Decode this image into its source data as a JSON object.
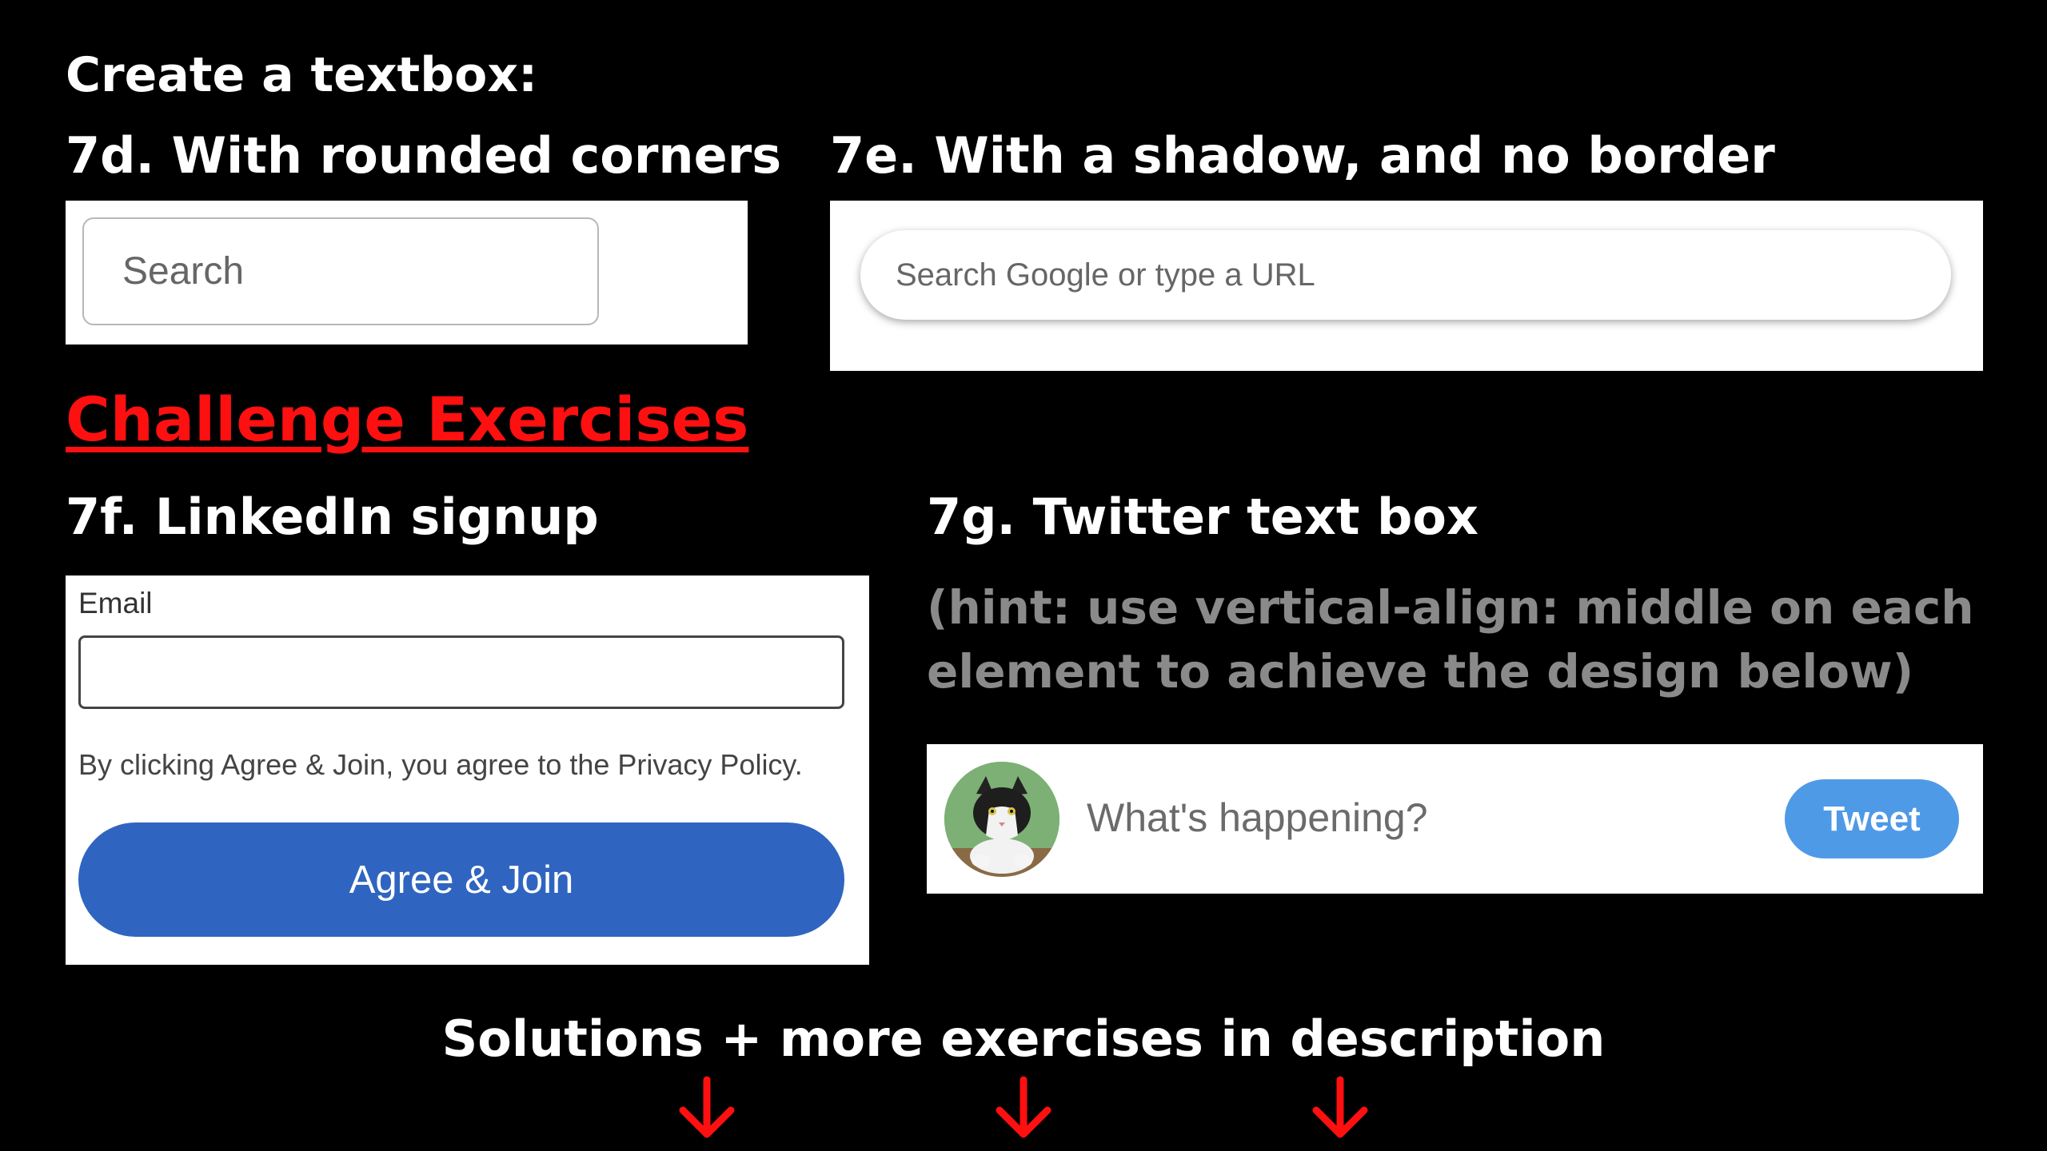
{
  "header": {
    "title": "Create a textbox:"
  },
  "exercise_7d": {
    "heading": "7d. With rounded corners",
    "input_placeholder": "Search"
  },
  "exercise_7e": {
    "heading": "7e. With a shadow, and no border",
    "input_placeholder": "Search Google or type a URL"
  },
  "challenge": {
    "title": "Challenge Exercises"
  },
  "exercise_7f": {
    "heading": "7f. LinkedIn signup",
    "email_label": "Email",
    "email_value": "",
    "agree_text": "By clicking Agree & Join, you agree to the Privacy Policy.",
    "button_label": "Agree & Join"
  },
  "exercise_7g": {
    "heading": "7g. Twitter text box",
    "hint": "(hint: use vertical-align: middle on each element to achieve the design below)",
    "avatar_icon": "cat-avatar",
    "placeholder": "What's happening?",
    "tweet_label": "Tweet"
  },
  "footer": {
    "text": "Solutions + more exercises in description"
  },
  "colors": {
    "background": "#000000",
    "challenge_red": "#ff1010",
    "linkedin_blue": "#2f65c0",
    "twitter_blue": "#4f9ae6",
    "hint_gray": "#8a8a8a"
  },
  "icons": [
    "arrow-down-icon",
    "arrow-down-icon",
    "arrow-down-icon"
  ]
}
